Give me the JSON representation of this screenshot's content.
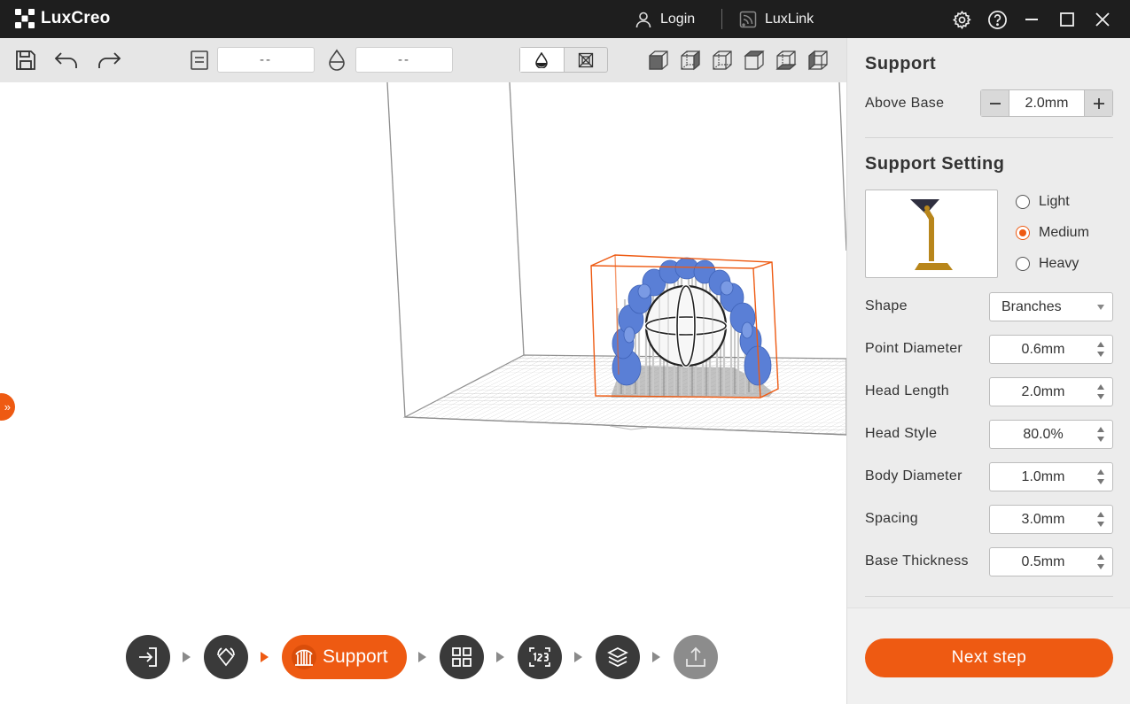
{
  "app": {
    "title": "LuxCreo"
  },
  "titlebar": {
    "login": "Login",
    "luxlink": "LuxLink"
  },
  "toolbar": {
    "field_one": "--",
    "field_two": "--"
  },
  "workflow": {
    "active_step_label": "Support"
  },
  "panel": {
    "support_title": "Support",
    "above_base_label": "Above Base",
    "above_base_value": "2.0mm",
    "setting_title": "Support Setting",
    "density_options": [
      "Light",
      "Medium",
      "Heavy"
    ],
    "density_selected": "Medium",
    "shape_label": "Shape",
    "shape_value": "Branches",
    "fields": [
      {
        "label": "Point Diameter",
        "value": "0.6mm"
      },
      {
        "label": "Head Length",
        "value": "2.0mm"
      },
      {
        "label": "Head Style",
        "value": "80.0%"
      },
      {
        "label": "Body Diameter",
        "value": "1.0mm"
      },
      {
        "label": "Spacing",
        "value": "3.0mm"
      },
      {
        "label": "Base Thickness",
        "value": "0.5mm"
      }
    ],
    "next_button": "Next step"
  },
  "colors": {
    "accent": "#ee5a12",
    "titlebar": "#1e1e1e",
    "model": "#5a7fd6",
    "panel": "#ececec"
  }
}
